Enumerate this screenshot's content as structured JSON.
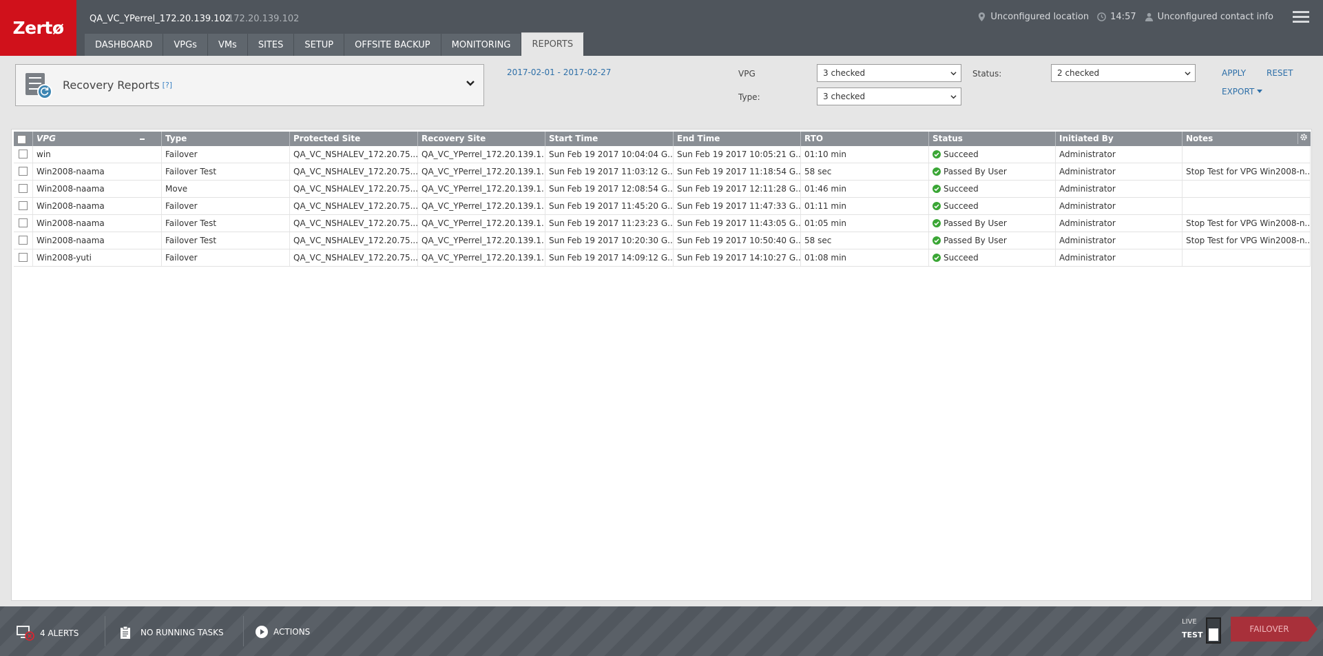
{
  "header": {
    "logo": "Zertø",
    "site_name": "QA_VC_YPerrel_172.20.139.102",
    "site_ip": "172.20.139.102",
    "location": "Unconfigured location",
    "time": "14:57",
    "contact": "Unconfigured contact info"
  },
  "tabs": [
    "DASHBOARD",
    "VPGs",
    "VMs",
    "SITES",
    "SETUP",
    "OFFSITE BACKUP",
    "MONITORING",
    "REPORTS"
  ],
  "active_tab": "REPORTS",
  "report": {
    "title": "Recovery Reports",
    "help": "[?]"
  },
  "filters": {
    "date_range": "2017-02-01 - 2017-02-27",
    "vpg_label": "VPG",
    "vpg_value": "3 checked",
    "type_label": "Type:",
    "type_value": "3 checked",
    "status_label": "Status:",
    "status_value": "2 checked",
    "apply": "APPLY",
    "reset": "RESET",
    "export": "EXPORT"
  },
  "columns": [
    "VPG",
    "Type",
    "Protected Site",
    "Recovery Site",
    "Start Time",
    "End Time",
    "RTO",
    "Status",
    "Initiated By",
    "Notes"
  ],
  "rows": [
    [
      "win",
      "Failover",
      "QA_VC_NSHALEV_172.20.75....",
      "QA_VC_YPerrel_172.20.139.1...",
      "Sun Feb 19 2017 10:04:04 G...",
      "Sun Feb 19 2017 10:05:21 G...",
      "01:10 min",
      "Succeed",
      "Administrator",
      ""
    ],
    [
      "Win2008-naama",
      "Failover Test",
      "QA_VC_NSHALEV_172.20.75....",
      "QA_VC_YPerrel_172.20.139.1...",
      "Sun Feb 19 2017 11:03:12 G...",
      "Sun Feb 19 2017 11:18:54 G...",
      "58 sec",
      "Passed By User",
      "Administrator",
      "Stop Test for VPG Win2008-n..."
    ],
    [
      "Win2008-naama",
      "Move",
      "QA_VC_NSHALEV_172.20.75....",
      "QA_VC_YPerrel_172.20.139.1...",
      "Sun Feb 19 2017 12:08:54 G...",
      "Sun Feb 19 2017 12:11:28 G...",
      "01:46 min",
      "Succeed",
      "Administrator",
      ""
    ],
    [
      "Win2008-naama",
      "Failover",
      "QA_VC_NSHALEV_172.20.75....",
      "QA_VC_YPerrel_172.20.139.1...",
      "Sun Feb 19 2017 11:45:20 G...",
      "Sun Feb 19 2017 11:47:33 G...",
      "01:11 min",
      "Succeed",
      "Administrator",
      ""
    ],
    [
      "Win2008-naama",
      "Failover Test",
      "QA_VC_NSHALEV_172.20.75....",
      "QA_VC_YPerrel_172.20.139.1...",
      "Sun Feb 19 2017 11:23:23 G...",
      "Sun Feb 19 2017 11:43:05 G...",
      "01:05 min",
      "Passed By User",
      "Administrator",
      "Stop Test for VPG Win2008-n..."
    ],
    [
      "Win2008-naama",
      "Failover Test",
      "QA_VC_NSHALEV_172.20.75....",
      "QA_VC_YPerrel_172.20.139.1...",
      "Sun Feb 19 2017 10:20:30 G...",
      "Sun Feb 19 2017 10:50:40 G...",
      "58 sec",
      "Passed By User",
      "Administrator",
      "Stop Test for VPG Win2008-n..."
    ],
    [
      "Win2008-yuti",
      "Failover",
      "QA_VC_NSHALEV_172.20.75....",
      "QA_VC_YPerrel_172.20.139.1...",
      "Sun Feb 19 2017 14:09:12 G...",
      "Sun Feb 19 2017 14:10:27 G...",
      "01:08 min",
      "Succeed",
      "Administrator",
      ""
    ]
  ],
  "footer": {
    "alerts": "4 ALERTS",
    "tasks": "NO RUNNING TASKS",
    "actions": "ACTIONS",
    "live": "LIVE",
    "test": "TEST",
    "failover": "FAILOVER"
  },
  "colors": {
    "brand_red": "#d0111b",
    "header_bg": "#4f555c",
    "link_blue": "#2d6fa8",
    "status_green": "#3aa635",
    "failover_red": "#a8303a"
  }
}
